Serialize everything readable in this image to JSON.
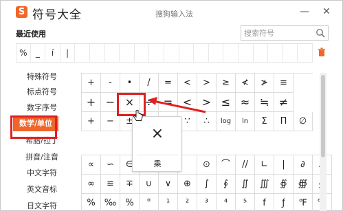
{
  "titlebar": {
    "app_title": "符号大全",
    "ime_name": "搜狗输入法",
    "logo_letter": "S"
  },
  "recent": {
    "label": "最近使用",
    "items": [
      "%",
      "_",
      "í",
      "|",
      "",
      "",
      "",
      "",
      "",
      "",
      "",
      "",
      "",
      "",
      "",
      "",
      "",
      "",
      "",
      ""
    ]
  },
  "search": {
    "placeholder": "搜索符号"
  },
  "sidebar": {
    "items": [
      {
        "label": "特殊符号",
        "active": false
      },
      {
        "label": "标点符号",
        "active": false
      },
      {
        "label": "数字序号",
        "active": false
      },
      {
        "label": "数学/单位",
        "active": true
      },
      {
        "label": "希腊/拉丁",
        "active": false
      },
      {
        "label": "拼音/注音",
        "active": false
      },
      {
        "label": "中文字符",
        "active": false
      },
      {
        "label": "英文音标",
        "active": false
      },
      {
        "label": "日文字符",
        "active": false
      }
    ]
  },
  "grid_top": [
    [
      "+",
      "-",
      "•",
      "/",
      "=",
      "<",
      ">",
      "≥",
      "≮",
      "≯",
      "≡"
    ],
    [
      "+",
      "−",
      "×",
      "÷",
      "=",
      "<",
      ">",
      "≤",
      "≈",
      "≒",
      "≠"
    ],
    [
      "+",
      "−",
      "±",
      "",
      "",
      "∵",
      "∴",
      "log",
      "ln",
      "Σ",
      "Π",
      "∅"
    ]
  ],
  "grid_bottom": [
    [
      "∝",
      "∽",
      "∈",
      "",
      "",
      "",
      "⊙",
      "⌒",
      "//",
      "∟",
      "|",
      "∂",
      "Δ"
    ],
    [
      "∞",
      "≌",
      "∓",
      "∪",
      "∨",
      "⊕",
      "∫",
      "∮",
      "∬",
      "∭",
      "∯",
      "∰",
      "∯"
    ],
    [
      "%",
      "‰",
      "%",
      "°",
      "¹",
      "²",
      "³",
      "⁴",
      "⁵",
      "f",
      "ƒ",
      "℉",
      "℃"
    ]
  ],
  "popup": {
    "glyph": "×",
    "name": "乘"
  },
  "colors": {
    "accent": "#f0662a",
    "highlight": "#e02020"
  },
  "icons": {
    "search": "search-icon",
    "trash": "trash-icon",
    "close": "close-icon",
    "minimize": "minimize-icon"
  }
}
